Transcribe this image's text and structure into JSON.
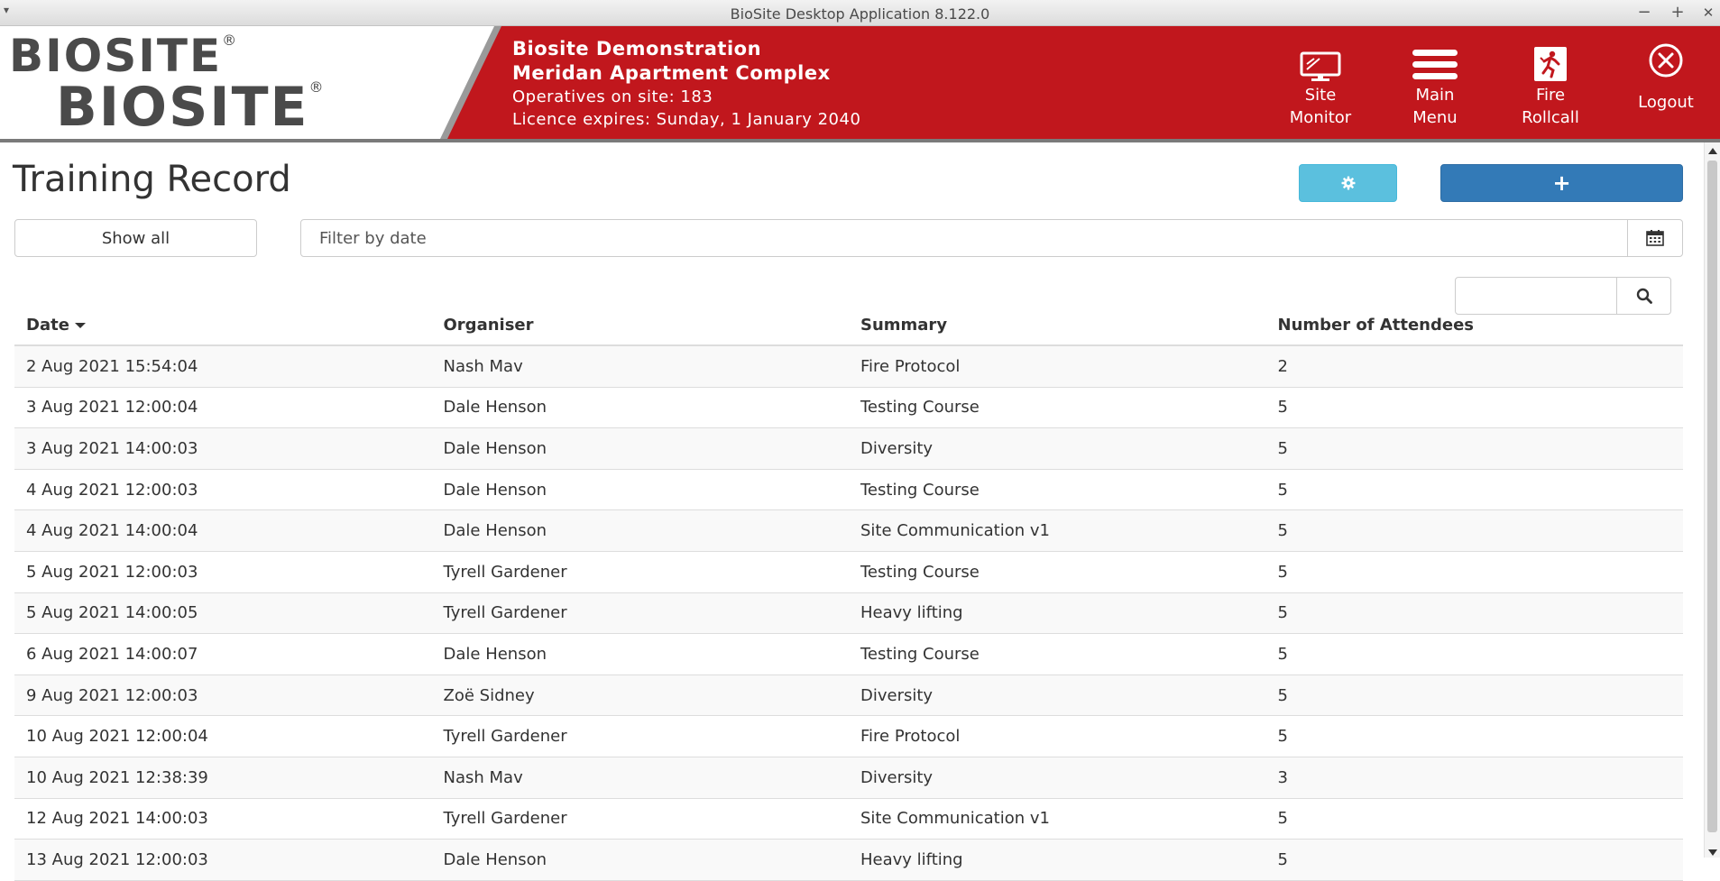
{
  "window": {
    "title": "BioSite Desktop Application 8.122.0",
    "controls": {
      "menu": "▾",
      "minimize": "−",
      "maximize": "+",
      "close": "✕"
    }
  },
  "header": {
    "logo": {
      "line1": "BIOSITE",
      "line2": "BIOSITE",
      "registered": "®"
    },
    "site_name": "Biosite Demonstration",
    "project_name": "Meridan Apartment Complex",
    "operatives": "Operatives on site: 183",
    "licence": "Licence expires: Sunday, 1 January 2040",
    "brand_color": "#c1171d",
    "nav": [
      {
        "icon": "monitor-icon",
        "line1": "Site",
        "line2": "Monitor"
      },
      {
        "icon": "menu-icon",
        "line1": "Main",
        "line2": "Menu"
      },
      {
        "icon": "fire-exit-icon",
        "line1": "Fire",
        "line2": "Rollcall"
      },
      {
        "icon": "logout-icon",
        "line1": "Logout",
        "line2": ""
      }
    ]
  },
  "page": {
    "title": "Training Record",
    "settings_button": {
      "icon": "gear-icon",
      "color": "#5bc0de"
    },
    "add_button": {
      "label": "+",
      "color": "#337ab7"
    },
    "show_all_label": "Show all",
    "date_filter_placeholder": "Filter by date",
    "search_placeholder": ""
  },
  "table": {
    "columns": [
      "Date",
      "Organiser",
      "Summary",
      "Number of Attendees"
    ],
    "sort": {
      "column": "Date",
      "direction": "desc"
    },
    "rows": [
      [
        "2 Aug 2021 15:54:04",
        "Nash Mav",
        "Fire Protocol",
        "2"
      ],
      [
        "3 Aug 2021 12:00:04",
        "Dale Henson",
        "Testing Course",
        "5"
      ],
      [
        "3 Aug 2021 14:00:03",
        "Dale Henson",
        "Diversity",
        "5"
      ],
      [
        "4 Aug 2021 12:00:03",
        "Dale Henson",
        "Testing Course",
        "5"
      ],
      [
        "4 Aug 2021 14:00:04",
        "Dale Henson",
        "Site Communication v1",
        "5"
      ],
      [
        "5 Aug 2021 12:00:03",
        "Tyrell Gardener",
        "Testing Course",
        "5"
      ],
      [
        "5 Aug 2021 14:00:05",
        "Tyrell Gardener",
        "Heavy lifting",
        "5"
      ],
      [
        "6 Aug 2021 14:00:07",
        "Dale Henson",
        "Testing Course",
        "5"
      ],
      [
        "9 Aug 2021 12:00:03",
        "Zoë Sidney",
        "Diversity",
        "5"
      ],
      [
        "10 Aug 2021 12:00:04",
        "Tyrell Gardener",
        "Fire Protocol",
        "5"
      ],
      [
        "10 Aug 2021 12:38:39",
        "Nash Mav",
        "Diversity",
        "3"
      ],
      [
        "12 Aug 2021 14:00:03",
        "Tyrell Gardener",
        "Site Communication v1",
        "5"
      ],
      [
        "13 Aug 2021 12:00:03",
        "Dale Henson",
        "Heavy lifting",
        "5"
      ]
    ]
  }
}
